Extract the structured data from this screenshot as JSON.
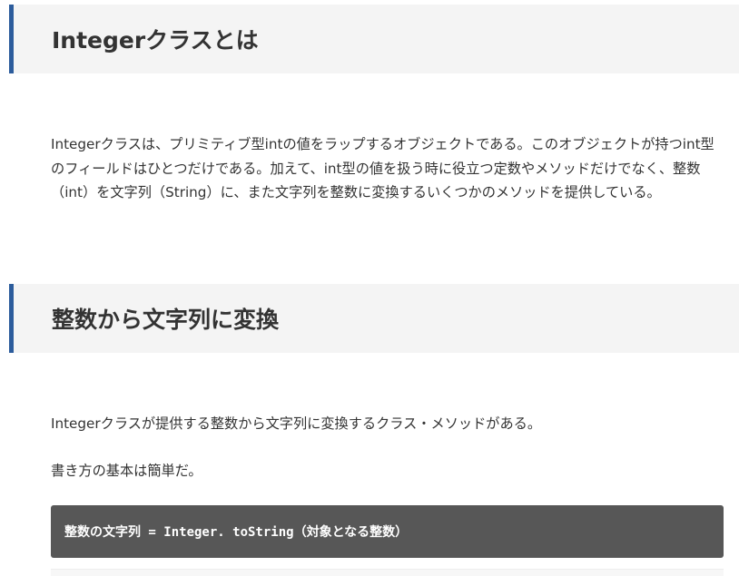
{
  "sections": [
    {
      "heading": "Integerクラスとは",
      "paragraphs": [
        "Integerクラスは、プリミティブ型intの値をラップするオブジェクトである。このオブジェクトが持つint型のフィールドはひとつだけである。加えて、int型の値を扱う時に役立つ定数やメソッドだけでなく、整数（int）を文字列（String）に、また文字列を整数に変換するいくつかのメソッドを提供している。"
      ]
    },
    {
      "heading": "整数から文字列に変換",
      "paragraphs": [
        "Integerクラスが提供する整数から文字列に変換するクラス・メソッドがある。",
        "書き方の基本は簡単だ。"
      ],
      "code": "整数の文字列 = Integer. toString（対象となる整数）"
    }
  ],
  "colors": {
    "heading_bar": "#2c5c9c",
    "heading_bg": "#f4f4f4",
    "code_bg": "#575757"
  }
}
